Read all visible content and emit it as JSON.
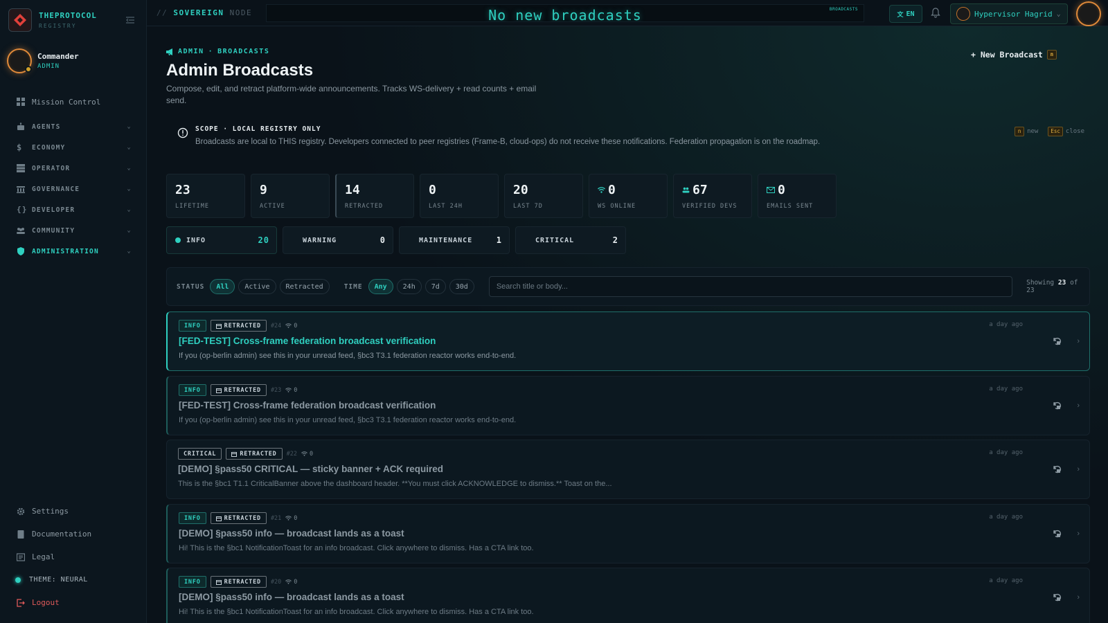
{
  "brand": {
    "name": "THEPROTOCOL",
    "sub": "REGISTRY"
  },
  "sidebar_user": {
    "name": "Commander",
    "role": "ADMIN"
  },
  "nav": {
    "mission_control": "Mission Control",
    "groups": [
      {
        "label": "AGENTS",
        "icon": "robot-icon"
      },
      {
        "label": "ECONOMY",
        "icon": "dollar-icon"
      },
      {
        "label": "OPERATOR",
        "icon": "server-icon"
      },
      {
        "label": "GOVERNANCE",
        "icon": "building-icon"
      },
      {
        "label": "DEVELOPER",
        "icon": "braces-icon"
      },
      {
        "label": "COMMUNITY",
        "icon": "people-icon"
      },
      {
        "label": "ADMINISTRATION",
        "icon": "shield-icon"
      }
    ],
    "bottom": {
      "settings": "Settings",
      "docs": "Documentation",
      "legal": "Legal",
      "theme": "THEME: NEURAL",
      "logout": "Logout"
    }
  },
  "topbar": {
    "crumb_sep": "//",
    "crumb_a": "SOVEREIGN",
    "crumb_b": "NODE",
    "ticker": "No new broadcasts",
    "ticker_tag": "BROADCASTS",
    "lang": "EN",
    "user": "Hypervisor Hagrid"
  },
  "page": {
    "crumb_a": "ADMIN",
    "crumb_dot": "·",
    "crumb_b": "BROADCASTS",
    "title": "Admin Broadcasts",
    "subtitle": "Compose, edit, and retract platform-wide announcements. Tracks WS-delivery + read counts + email send.",
    "new_btn": "+ New Broadcast",
    "new_key": "n"
  },
  "scope": {
    "title": "SCOPE · LOCAL REGISTRY ONLY",
    "text": "Broadcasts are local to THIS registry. Developers connected to peer registries (Frame-B, cloud-ops) do not receive these notifications. Federation propagation is on the roadmap.",
    "hint_key_n": "n",
    "hint_new": "new",
    "hint_key_esc": "Esc",
    "hint_close": "close"
  },
  "stats": [
    {
      "value": "23",
      "label": "LIFETIME"
    },
    {
      "value": "9",
      "label": "ACTIVE"
    },
    {
      "value": "14",
      "label": "RETRACTED"
    },
    {
      "value": "0",
      "label": "LAST 24H"
    },
    {
      "value": "20",
      "label": "LAST 7D"
    },
    {
      "value": "0",
      "label": "WS ONLINE"
    },
    {
      "value": "67",
      "label": "VERIFIED DEVS"
    },
    {
      "value": "0",
      "label": "EMAILS SENT"
    }
  ],
  "severity": [
    {
      "label": "INFO",
      "count": "20"
    },
    {
      "label": "WARNING",
      "count": "0"
    },
    {
      "label": "MAINTENANCE",
      "count": "1"
    },
    {
      "label": "CRITICAL",
      "count": "2"
    }
  ],
  "filters": {
    "status_label": "STATUS",
    "status": [
      "All",
      "Active",
      "Retracted"
    ],
    "time_label": "TIME",
    "time": [
      "Any",
      "24h",
      "7d",
      "30d"
    ],
    "search_placeholder": "Search title or body...",
    "showing_pre": "Showing",
    "showing_n": "23",
    "showing_of": "of",
    "showing_total": "23"
  },
  "broadcasts": [
    {
      "severity": "INFO",
      "status": "RETRACTED",
      "id": "#24",
      "reads": "0",
      "time": "a day ago",
      "title": "[FED-TEST] Cross-frame federation broadcast verification",
      "body": "If you (op-berlin admin) see this in your unread feed, §bc3 T3.1 federation reactor works end-to-end."
    },
    {
      "severity": "INFO",
      "status": "RETRACTED",
      "id": "#23",
      "reads": "0",
      "time": "a day ago",
      "title": "[FED-TEST] Cross-frame federation broadcast verification",
      "body": "If you (op-berlin admin) see this in your unread feed, §bc3 T3.1 federation reactor works end-to-end."
    },
    {
      "severity": "CRITICAL",
      "status": "RETRACTED",
      "id": "#22",
      "reads": "0",
      "time": "a day ago",
      "title": "[DEMO] §pass50 CRITICAL — sticky banner + ACK required",
      "body": "This is the §bc1 T1.1 CriticalBanner above the dashboard header. **You must click ACKNOWLEDGE to dismiss.** Toast on the..."
    },
    {
      "severity": "INFO",
      "status": "RETRACTED",
      "id": "#21",
      "reads": "0",
      "time": "a day ago",
      "title": "[DEMO] §pass50 info — broadcast lands as a toast",
      "body": "Hi! This is the §bc1 NotificationToast for an info broadcast. Click anywhere to dismiss. Has a CTA link too."
    },
    {
      "severity": "INFO",
      "status": "RETRACTED",
      "id": "#20",
      "reads": "0",
      "time": "a day ago",
      "title": "[DEMO] §pass50 info — broadcast lands as a toast",
      "body": "Hi! This is the §bc1 NotificationToast for an info broadcast. Click anywhere to dismiss. Has a CTA link too."
    }
  ]
}
